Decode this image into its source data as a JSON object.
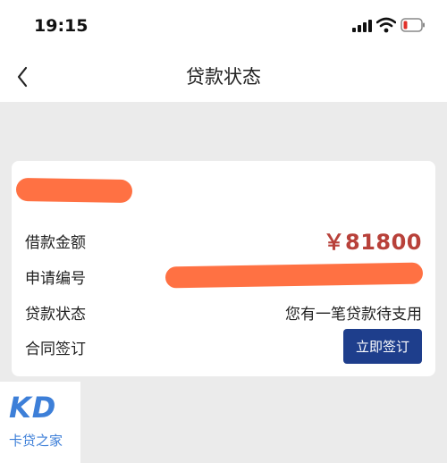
{
  "status_bar": {
    "time": "19:15"
  },
  "nav": {
    "back_icon": "chevron-left-icon",
    "title": "贷款状态"
  },
  "loan": {
    "amount_label": "借款金额",
    "amount_value": "￥81800",
    "application_no_label": "申请编号",
    "status_label": "贷款状态",
    "status_value": "您有一笔贷款待支用",
    "contract_label": "合同签订",
    "sign_button": "立即签订"
  },
  "watermark": {
    "logo": "KD",
    "text": "卡贷之家"
  },
  "colors": {
    "amount": "#b8413a",
    "button": "#1e3e8c",
    "redaction": "#ff7143",
    "watermark": "#3d7fd8"
  }
}
